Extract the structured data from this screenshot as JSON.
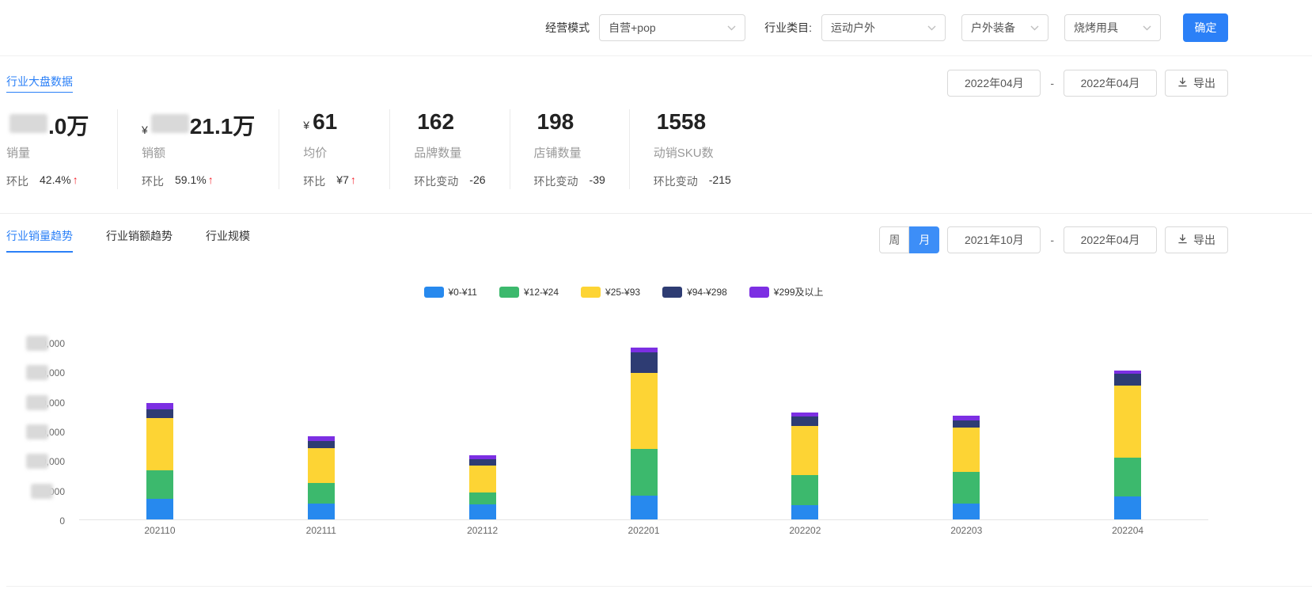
{
  "filters": {
    "business_mode_label": "经营模式",
    "business_mode_value": "自营+pop",
    "category_label": "行业类目:",
    "category_value": "运动户外",
    "subcategory_value": "户外装备",
    "subsubcategory_value": "烧烤用具",
    "confirm_label": "确定"
  },
  "overview": {
    "title": "行业大盘数据",
    "date_start": "2022年04月",
    "date_separator": "-",
    "date_end": "2022年04月",
    "export_label": "导出",
    "stats": [
      {
        "currency": "",
        "redacted": true,
        "value": ".0万",
        "label": "销量",
        "sub_label": "环比",
        "sub_value": "42.4%",
        "trend": "up"
      },
      {
        "currency": "¥",
        "redacted": true,
        "value": "21.1万",
        "label": "销额",
        "sub_label": "环比",
        "sub_value": "59.1%",
        "trend": "up"
      },
      {
        "currency": "¥",
        "redacted": false,
        "value": "61",
        "label": "均价",
        "sub_label": "环比",
        "sub_value": "¥7",
        "trend": "up"
      },
      {
        "currency": "",
        "redacted": false,
        "value": "162",
        "label": "品牌数量",
        "sub_label": "环比变动",
        "sub_value": "-26",
        "trend": ""
      },
      {
        "currency": "",
        "redacted": false,
        "value": "198",
        "label": "店铺数量",
        "sub_label": "环比变动",
        "sub_value": "-39",
        "trend": ""
      },
      {
        "currency": "",
        "redacted": false,
        "value": "1558",
        "label": "动销SKU数",
        "sub_label": "环比变动",
        "sub_value": "-215",
        "trend": ""
      }
    ]
  },
  "trend": {
    "tabs": [
      {
        "label": "行业销量趋势",
        "active": true
      },
      {
        "label": "行业销额趋势",
        "active": false
      },
      {
        "label": "行业规模",
        "active": false
      }
    ],
    "week_label": "周",
    "month_label": "月",
    "date_start": "2021年10月",
    "date_separator": "-",
    "date_end": "2022年04月",
    "export_label": "导出"
  },
  "chart_data": {
    "type": "bar",
    "stacked": true,
    "title": "",
    "xlabel": "",
    "ylabel": "",
    "categories": [
      "202110",
      "202111",
      "202112",
      "202201",
      "202202",
      "202203",
      "202204"
    ],
    "series": [
      {
        "name": "¥0-¥11",
        "color": "#2789ee",
        "values": [
          35000,
          27000,
          25000,
          40000,
          24000,
          27000,
          39000
        ]
      },
      {
        "name": "¥12-¥24",
        "color": "#3cb96d",
        "values": [
          48000,
          35000,
          20000,
          79000,
          51000,
          54000,
          66000
        ]
      },
      {
        "name": "¥25-¥93",
        "color": "#fdd434",
        "values": [
          88000,
          58000,
          46000,
          129000,
          83000,
          74000,
          122000
        ]
      },
      {
        "name": "¥94-¥298",
        "color": "#2e3c73",
        "values": [
          15000,
          13000,
          11000,
          34000,
          16000,
          13000,
          20000
        ]
      },
      {
        "name": "¥299及以上",
        "color": "#7c2fe3",
        "values": [
          11000,
          8000,
          7000,
          8000,
          7000,
          7000,
          5000
        ]
      }
    ],
    "ylim": [
      0,
      300000
    ],
    "ytick_interval": 50000,
    "legend_position": "top",
    "grid": false,
    "yticks_partially_redacted": true
  }
}
